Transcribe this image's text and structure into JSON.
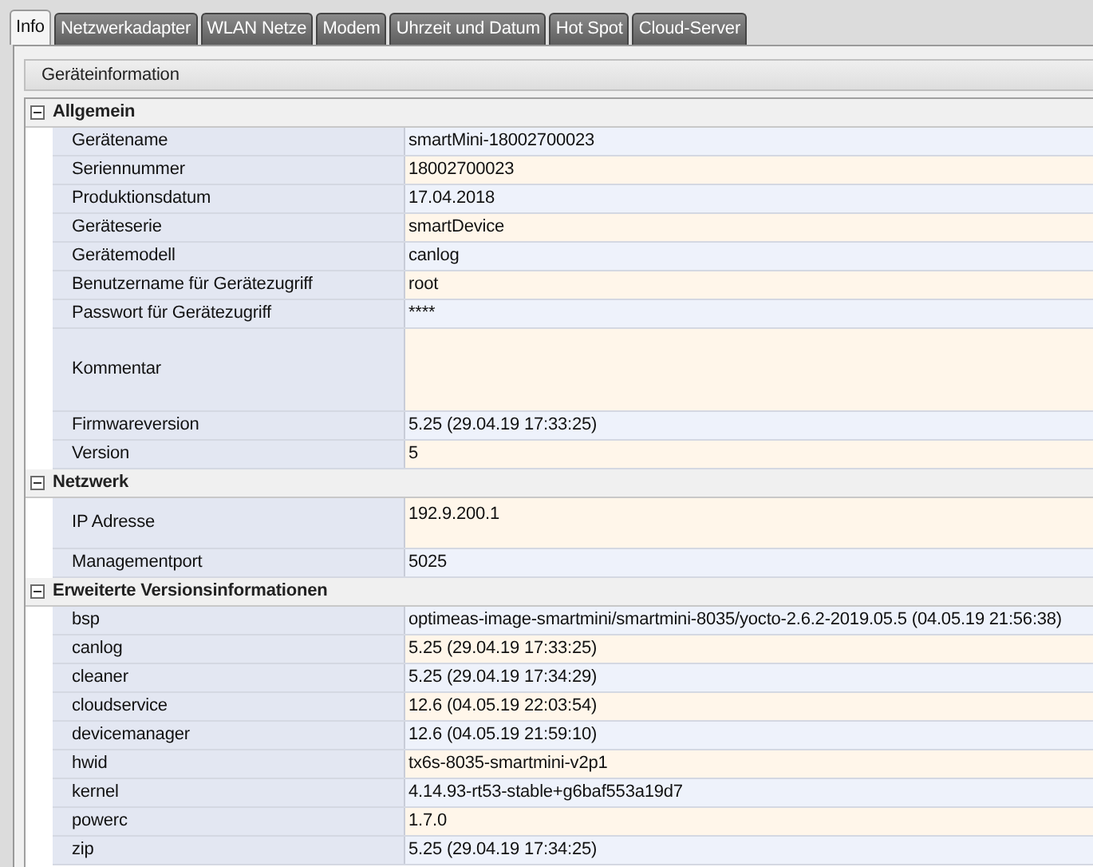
{
  "tabs": [
    {
      "label": "Info",
      "selected": true
    },
    {
      "label": "Netzwerkadapter",
      "selected": false
    },
    {
      "label": "WLAN Netze",
      "selected": false
    },
    {
      "label": "Modem",
      "selected": false
    },
    {
      "label": "Uhrzeit und Datum",
      "selected": false
    },
    {
      "label": "Hot Spot",
      "selected": false
    },
    {
      "label": "Cloud-Server",
      "selected": false
    }
  ],
  "panel": {
    "title": "Geräteinformation",
    "groups": [
      {
        "title": "Allgemein",
        "expanded": true,
        "rows": [
          {
            "label": "Gerätename",
            "value": "smartMini-18002700023",
            "kind": "line"
          },
          {
            "label": "Seriennummer",
            "value": "18002700023",
            "kind": "line"
          },
          {
            "label": "Produktionsdatum",
            "value": "17.04.2018",
            "kind": "line"
          },
          {
            "label": "Geräteserie",
            "value": "smartDevice",
            "kind": "line"
          },
          {
            "label": "Gerätemodell",
            "value": "canlog",
            "kind": "line"
          },
          {
            "label": "Benutzername für Gerätezugriff",
            "value": "root",
            "kind": "line"
          },
          {
            "label": "Passwort für Gerätezugriff",
            "value": "****",
            "kind": "line"
          },
          {
            "label": "Kommentar",
            "kind": "textarea"
          },
          {
            "label": "Firmwareversion",
            "value": "5.25 (29.04.19 17:33:25)",
            "kind": "line"
          },
          {
            "label": "Version",
            "value": "5",
            "kind": "line"
          }
        ]
      },
      {
        "title": "Netzwerk",
        "expanded": true,
        "rows": [
          {
            "label": "IP Adresse",
            "value": "192.9.200.1",
            "kind": "double"
          },
          {
            "label": "Managementport",
            "value": "5025",
            "kind": "line"
          }
        ]
      },
      {
        "title": "Erweiterte Versionsinformationen",
        "expanded": true,
        "rows": [
          {
            "label": "bsp",
            "value": "optimeas-image-smartmini/smartmini-8035/yocto-2.6.2-2019.05.5 (04.05.19 21:56:38)",
            "kind": "line"
          },
          {
            "label": "canlog",
            "value": "5.25 (29.04.19 17:33:25)",
            "kind": "line"
          },
          {
            "label": "cleaner",
            "value": "5.25 (29.04.19 17:34:29)",
            "kind": "line"
          },
          {
            "label": "cloudservice",
            "value": "12.6 (04.05.19 22:03:54)",
            "kind": "line"
          },
          {
            "label": "devicemanager",
            "value": "12.6 (04.05.19 21:59:10)",
            "kind": "line"
          },
          {
            "label": "hwid",
            "value": "tx6s-8035-smartmini-v2p1",
            "kind": "line"
          },
          {
            "label": "kernel",
            "value": "4.14.93-rt53-stable+g6baf553a19d7",
            "kind": "line"
          },
          {
            "label": "powerc",
            "value": "1.7.0",
            "kind": "line"
          },
          {
            "label": "zip",
            "value": "5.25 (29.04.19 17:34:25)",
            "kind": "line"
          }
        ]
      }
    ]
  }
}
